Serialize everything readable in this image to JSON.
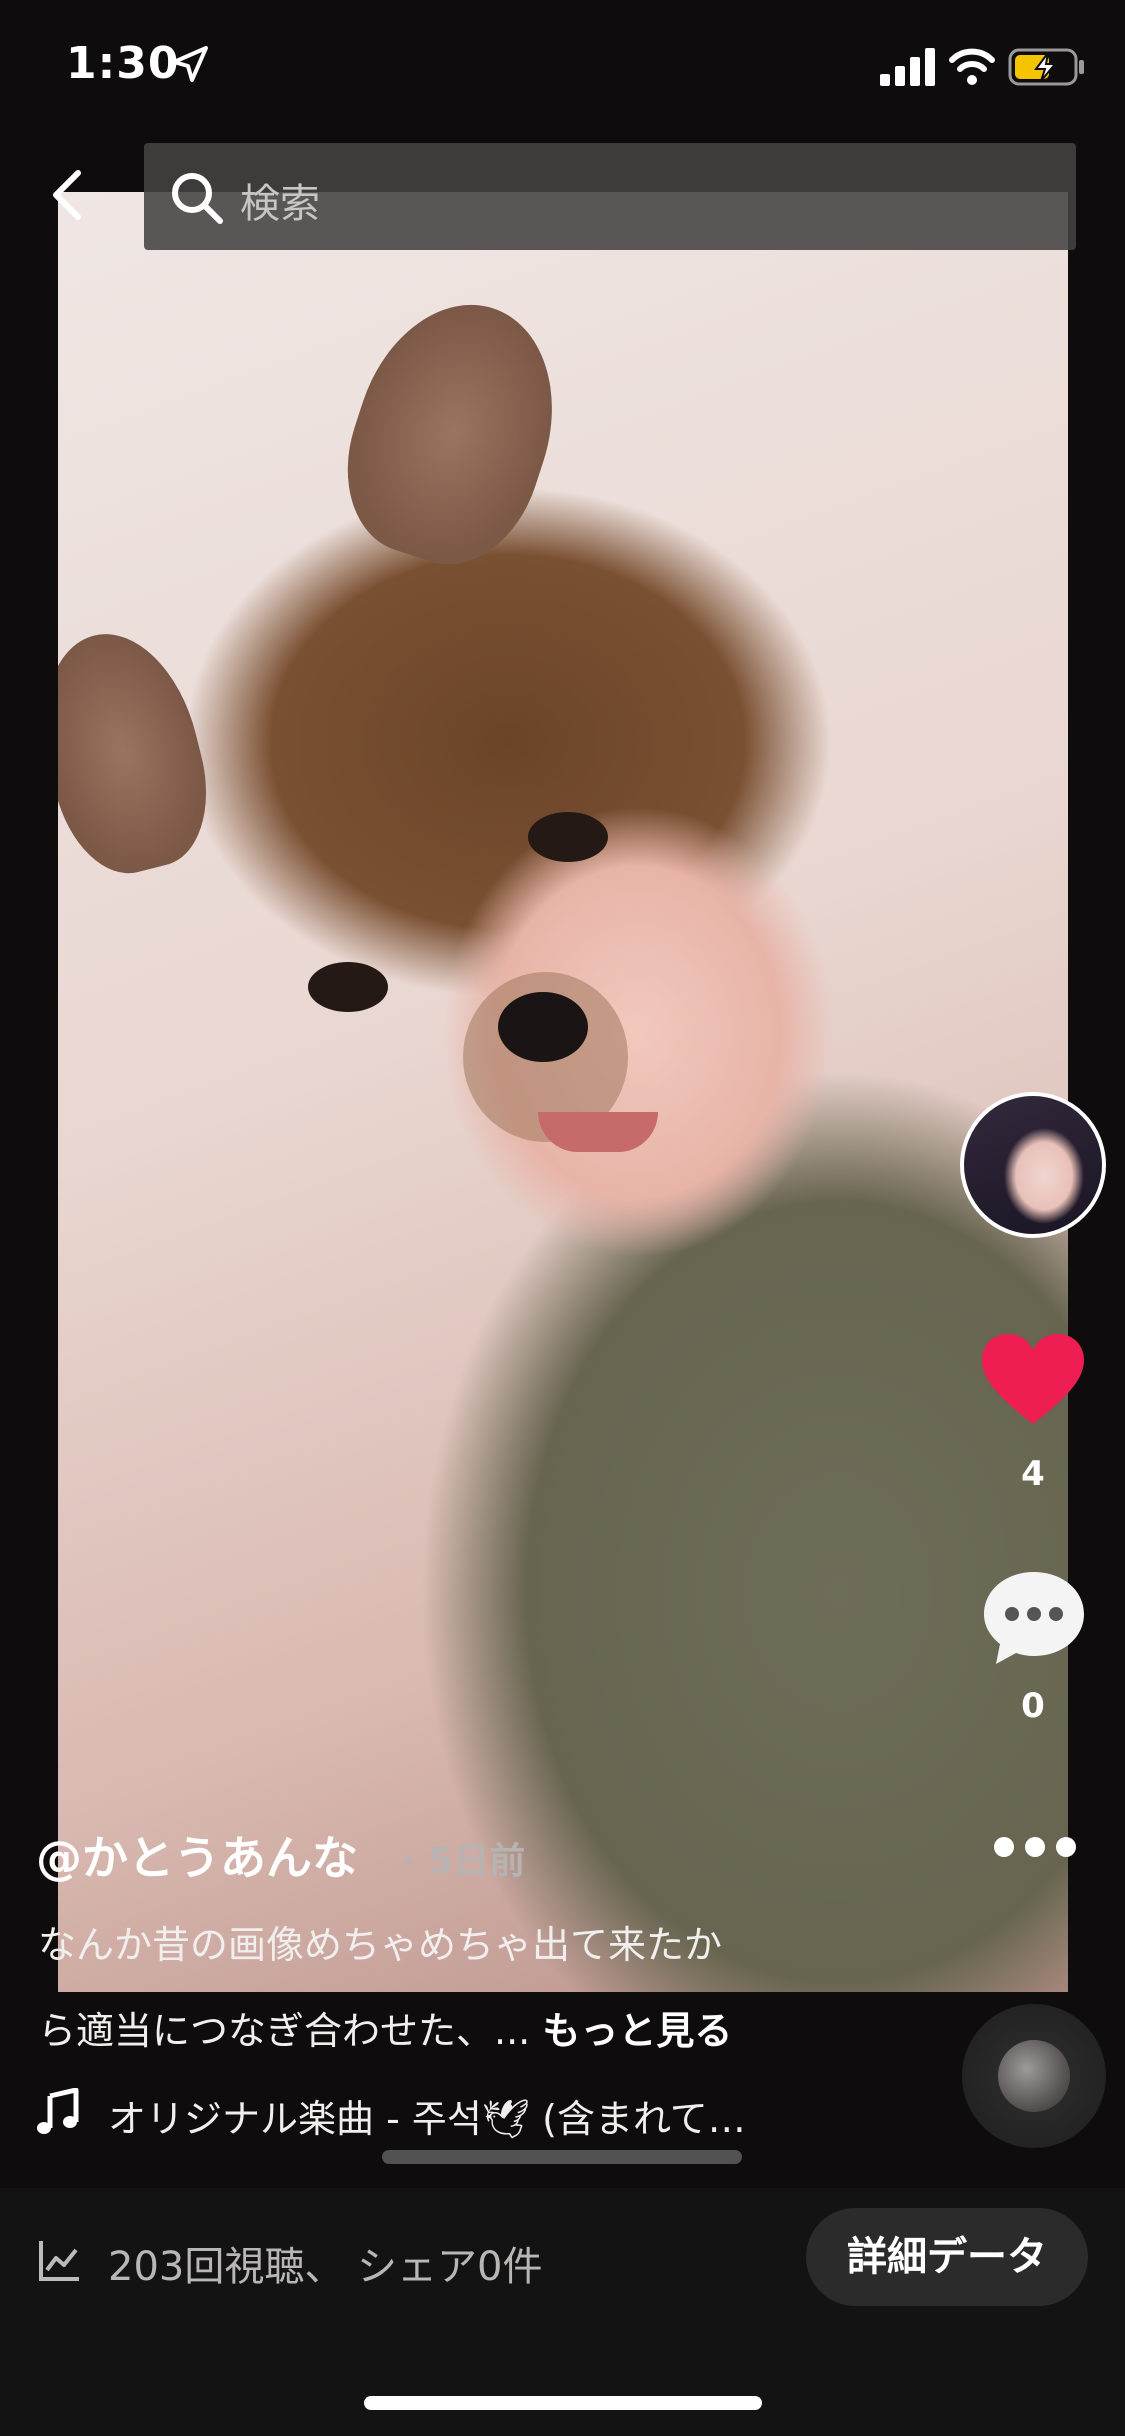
{
  "status": {
    "time": "1:30"
  },
  "search": {
    "placeholder": "検索"
  },
  "post": {
    "username": "@かとうあんな",
    "time_ago": "· 5日前",
    "caption_line1": "なんか昔の画像めちゃめちゃ出て来たか",
    "caption_line2": "ら適当につなぎ合わせた、...",
    "see_more": "もっと見る",
    "music": "オリジナル楽曲 - 주석🕊 (含まれて…"
  },
  "actions": {
    "likes": "4",
    "comments": "0"
  },
  "stats": {
    "text": "203回視聴、 シェア0件",
    "detail_button": "詳細データ"
  },
  "colors": {
    "heart": "#ee1d52",
    "background": "#0f0c0d"
  }
}
